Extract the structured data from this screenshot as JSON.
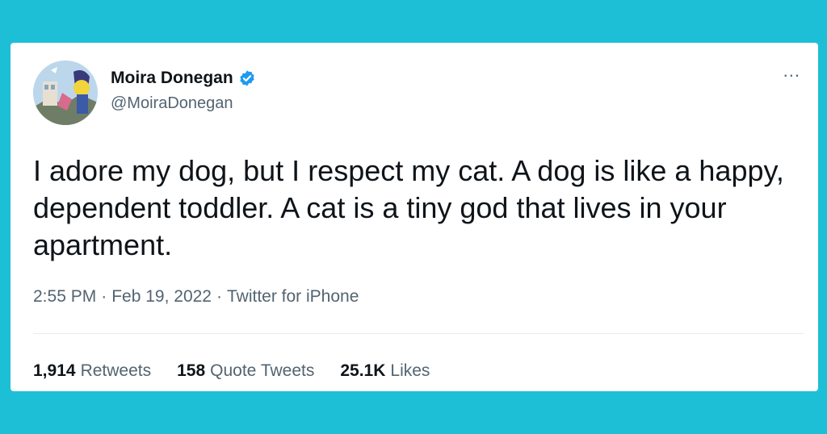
{
  "colors": {
    "background": "#1dbfd6",
    "verified_badge": "#1d9bf0",
    "secondary_text": "#536471",
    "primary_text": "#0f1419"
  },
  "author": {
    "display_name": "Moira Donegan",
    "handle": "@MoiraDonegan",
    "verified_icon": "verified-badge-icon",
    "avatar_icon": "avatar-image"
  },
  "menu": {
    "more_label": "...",
    "icon": "more-icon"
  },
  "tweet": {
    "text": "I adore my dog, but I respect my cat. A dog is like a happy, dependent toddler. A cat is a tiny god that lives in your apartment.",
    "time": "2:55 PM",
    "separator": "·",
    "date": "Feb 19, 2022",
    "source": "Twitter for iPhone"
  },
  "stats": {
    "retweets_count": "1,914",
    "retweets_label": "Retweets",
    "quotes_count": "158",
    "quotes_label": "Quote Tweets",
    "likes_count": "25.1K",
    "likes_label": "Likes"
  }
}
